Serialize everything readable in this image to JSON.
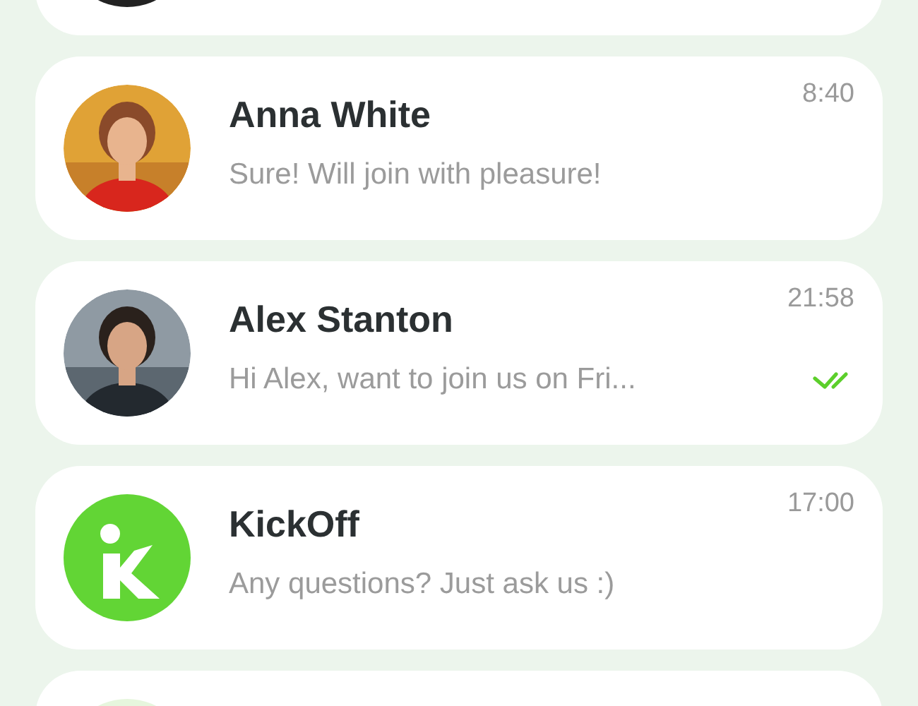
{
  "chats": [
    {
      "name": "Anna White",
      "time": "8:40",
      "message": "Sure! Will join with pleasure!",
      "read": false
    },
    {
      "name": "Alex Stanton",
      "time": "21:58",
      "message": "Hi Alex, want to join us on Fri...",
      "read": true
    },
    {
      "kind": "logo",
      "name": "KickOff",
      "time": "17:00",
      "message": "Any questions? Just ask us :)",
      "read": false
    }
  ]
}
